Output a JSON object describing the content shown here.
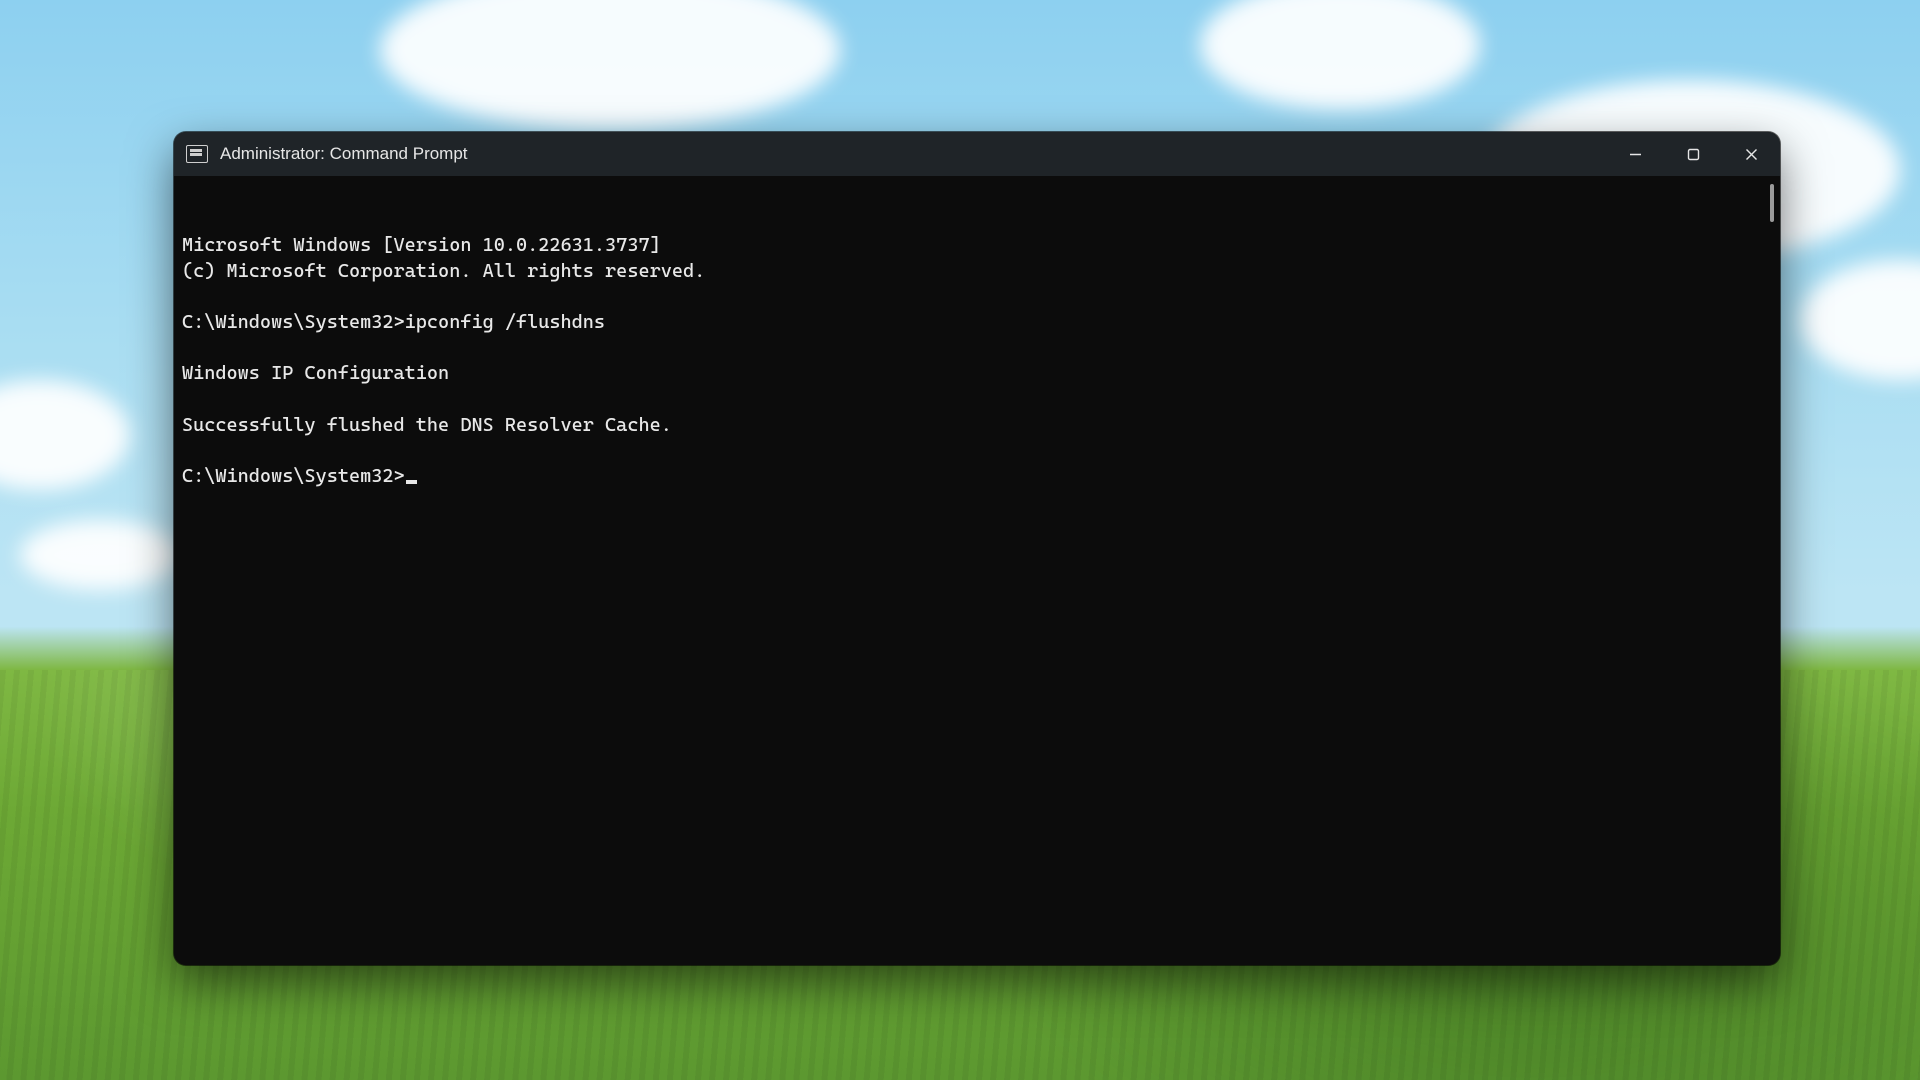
{
  "window": {
    "title": "Administrator: Command Prompt"
  },
  "terminal": {
    "lines": [
      "Microsoft Windows [Version 10.0.22631.3737]",
      "(c) Microsoft Corporation. All rights reserved.",
      "",
      "C:\\Windows\\System32>ipconfig /flushdns",
      "",
      "Windows IP Configuration",
      "",
      "Successfully flushed the DNS Resolver Cache.",
      ""
    ],
    "current_prompt": "C:\\Windows\\System32>"
  }
}
